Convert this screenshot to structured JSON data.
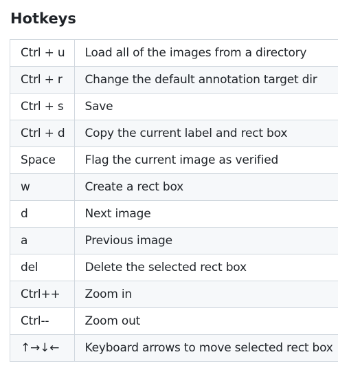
{
  "heading": "Hotkeys",
  "rows": [
    {
      "key": "Ctrl + u",
      "description": "Load all of the images from a directory"
    },
    {
      "key": "Ctrl + r",
      "description": "Change the default annotation target dir"
    },
    {
      "key": "Ctrl + s",
      "description": "Save"
    },
    {
      "key": "Ctrl + d",
      "description": "Copy the current label and rect box"
    },
    {
      "key": "Space",
      "description": "Flag the current image as verified"
    },
    {
      "key": "w",
      "description": "Create a rect box"
    },
    {
      "key": "d",
      "description": "Next image"
    },
    {
      "key": "a",
      "description": "Previous image"
    },
    {
      "key": "del",
      "description": "Delete the selected rect box"
    },
    {
      "key": "Ctrl++",
      "description": "Zoom in"
    },
    {
      "key": "Ctrl--",
      "description": "Zoom out"
    },
    {
      "key": "↑→↓←",
      "description": "Keyboard arrows to move selected rect box"
    }
  ]
}
